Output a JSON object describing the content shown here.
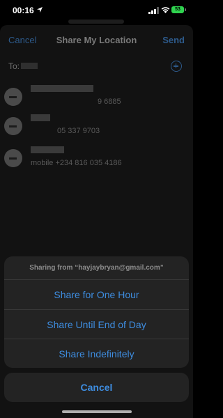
{
  "status_bar": {
    "time": "00:16",
    "battery": "53",
    "battery_color": "#2fd34f",
    "icons": [
      "location-arrow-icon",
      "signal-bars-icon",
      "wifi-icon",
      "battery-icon"
    ]
  },
  "nav": {
    "cancel_label": "Cancel",
    "title": "Share My Location",
    "send_label": "Send"
  },
  "recipients": {
    "to_label": "To:",
    "add_icon": "plus-circle-icon"
  },
  "contacts": [
    {
      "subtitle": "9 6885"
    },
    {
      "subtitle": "05 337 9703"
    },
    {
      "subtitle": "mobile +234 816 035 4186"
    }
  ],
  "action_sheet": {
    "header": "Sharing from “hayjaybryan@gmail.com”",
    "options": [
      "Share for One Hour",
      "Share Until End of Day",
      "Share Indefinitely"
    ],
    "cancel_label": "Cancel",
    "accent_color": "#3e8de0"
  }
}
